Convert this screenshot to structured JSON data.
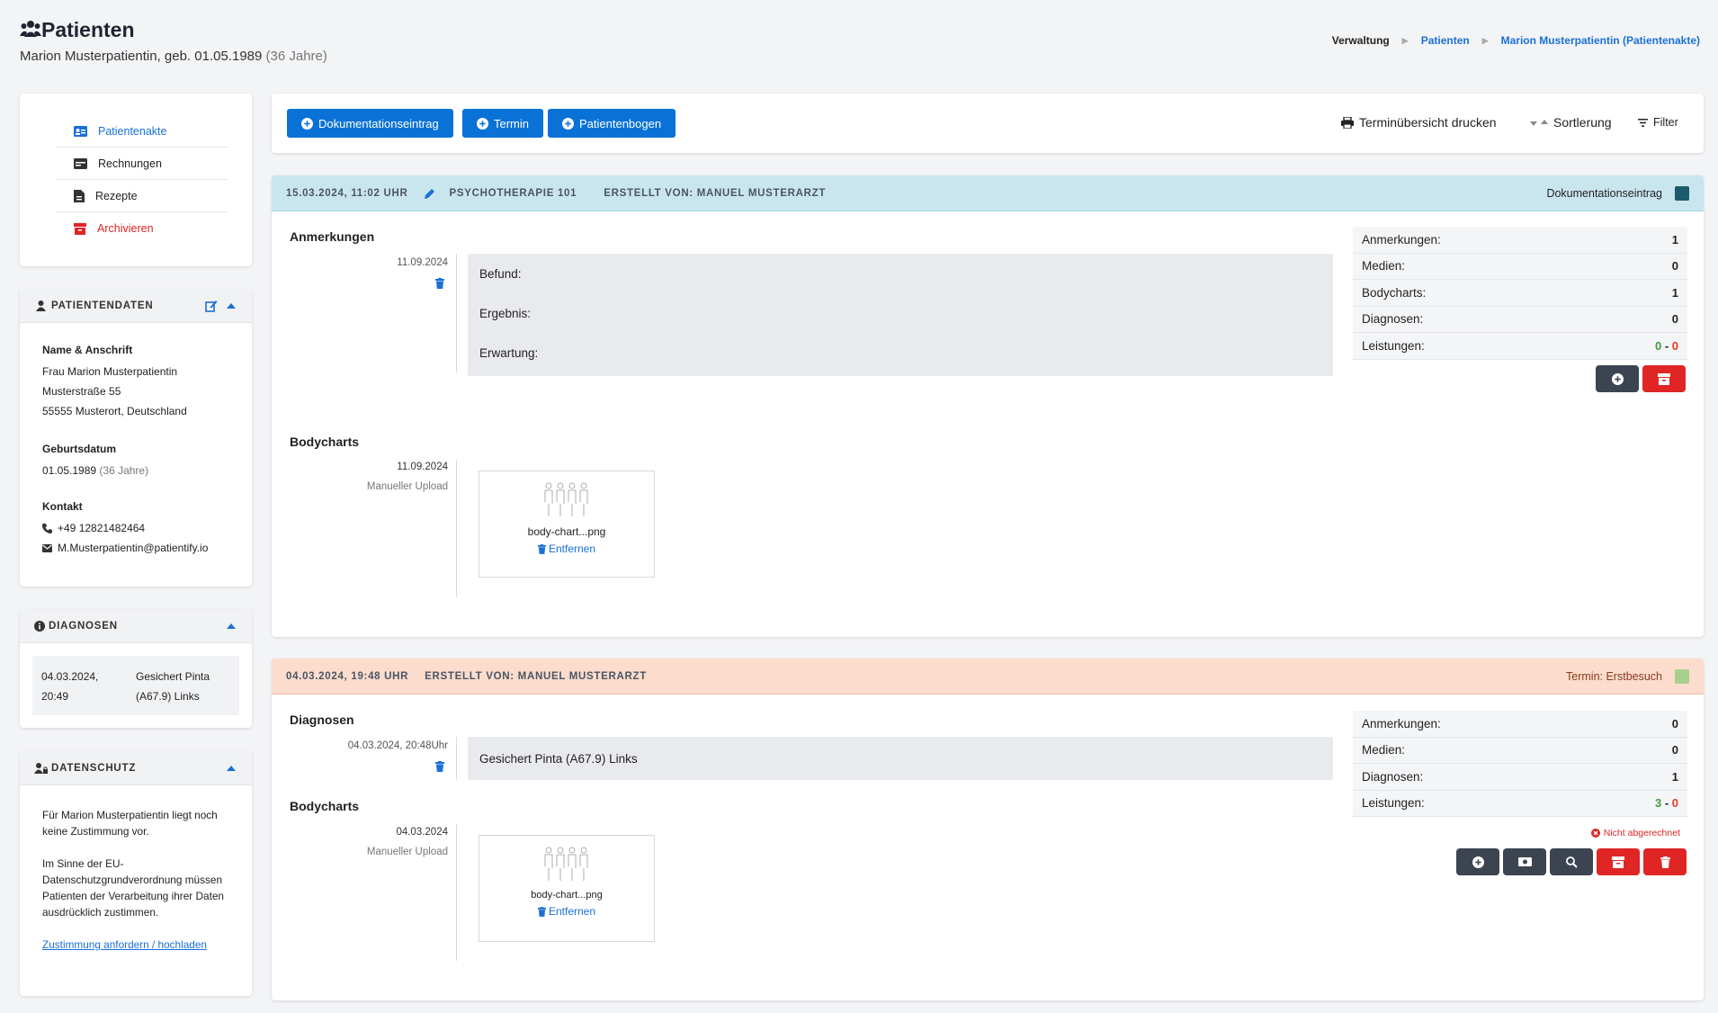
{
  "header": {
    "title": "Patienten",
    "subtitle_main": "Marion Musterpatientin, geb. 01.05.1989",
    "subtitle_age": "(36 Jahre)",
    "breadcrumb": [
      "Verwaltung",
      "Patienten",
      "Marion Musterpatientin (Patientenakte)"
    ]
  },
  "nav": {
    "items": [
      {
        "label": "Patientenakte",
        "icon": "id-card-icon",
        "color": "#1a6fd6"
      },
      {
        "label": "Rechnungen",
        "icon": "money-card-icon",
        "color": "#222"
      },
      {
        "label": "Rezepte",
        "icon": "file-prescription-icon",
        "color": "#222"
      },
      {
        "label": "Archivieren",
        "icon": "archive-icon",
        "color": "#e02525"
      }
    ]
  },
  "patient": {
    "heading": "PATIENTENDATEN",
    "name_label": "Name & Anschrift",
    "name": "Frau Marion Musterpatientin",
    "street": "Musterstraße 55",
    "city": "55555 Musterort, Deutschland",
    "birth_label": "Geburtsdatum",
    "birth": "01.05.1989",
    "birth_age": "(36 Jahre)",
    "contact_label": "Kontakt",
    "phone": "+49 12821482464",
    "email": "M.Musterpatientin@patientify.io"
  },
  "diagnoses": {
    "heading": "DIAGNOSEN",
    "rows": [
      {
        "date1": "04.03.2024,",
        "date2": "20:49",
        "text1": "Gesichert Pinta",
        "text2": "(A67.9) Links"
      }
    ]
  },
  "privacy": {
    "heading": "DATENSCHUTZ",
    "p1": "Für Marion Musterpatientin liegt noch keine Zustimmung vor.",
    "p2": "Im Sinne der EU-Datenschutzgrundverordnung müssen Patienten der Verarbeitung ihrer Daten ausdrücklich zustimmen.",
    "link": "Zustimmung anfordern / hochladen"
  },
  "toolbar": {
    "btn1": "Dokumentationseintrag",
    "btn2": "Termin",
    "btn3": "Patientenbogen",
    "print": "Terminübersicht drucken",
    "sort": "Sortlerung",
    "filter": "Filter"
  },
  "entry1": {
    "date": "15.03.2024, 11:02 UHR",
    "category": "PSYCHOTHERAPIE 101",
    "author": "ERSTELLT VON: MANUEL MUSTERARZT",
    "type": "Dokumentationseintrag",
    "type_color": "#1d5c6b",
    "header_bg": "#c9e6ef",
    "notes_title": "Anmerkungen",
    "notes_date": "11.09.2024",
    "notes": [
      "Befund:",
      "Ergebnis:",
      "Erwartung:"
    ],
    "bodycharts_title": "Bodycharts",
    "bc_date": "11.09.2024",
    "bc_source": "Manueller Upload",
    "bc_file": "body-chart...png",
    "bc_remove": "Entfernen",
    "stats": [
      {
        "label": "Anmerkungen:",
        "value": "1"
      },
      {
        "label": "Medien:",
        "value": "0"
      },
      {
        "label": "Bodycharts:",
        "value": "1"
      },
      {
        "label": "Diagnosen:",
        "value": "0"
      }
    ],
    "leistungen_label": "Leistungen:",
    "leistungen_a": "0",
    "leistungen_b": "0"
  },
  "entry2": {
    "date": "04.03.2024, 19:48 UHR",
    "author": "ERSTELLT VON: MANUEL MUSTERARZT",
    "type": "Termin: Erstbesuch",
    "type_color": "#a8d08d",
    "header_bg": "#fbdccd",
    "diag_title": "Diagnosen",
    "diag_date": "04.03.2024, 20:48Uhr",
    "diag_text": "Gesichert Pinta (A67.9) Links",
    "bodycharts_title": "Bodycharts",
    "bc_date": "04.03.2024",
    "bc_source": "Manueller Upload",
    "bc_file": "body-chart...png",
    "bc_remove": "Entfernen",
    "stats": [
      {
        "label": "Anmerkungen:",
        "value": "0"
      },
      {
        "label": "Medien:",
        "value": "0"
      },
      {
        "label": "Diagnosen:",
        "value": "1"
      }
    ],
    "leistungen_label": "Leistungen:",
    "leistungen_a": "3",
    "leistungen_b": "0",
    "unbilled": "Nicht abgerechnet"
  }
}
